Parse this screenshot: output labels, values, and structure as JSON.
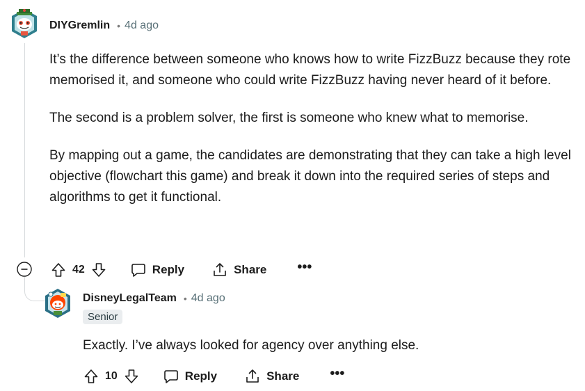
{
  "comment": {
    "author": "DIYGremlin",
    "separator": "•",
    "time": "4d ago",
    "paragraphs": [
      "It’s the difference between someone who knows how to write FizzBuzz because they rote memorised it, and someone who could write FizzBuzz having never heard of it before.",
      "The second is a problem solver, the first is someone who knew what to memorise.",
      "By mapping out a game, the candidates are demonstrating that they can take a high level objective (flowchart this game) and break it down into the required series of steps and algorithms to get it functional."
    ],
    "votes": "42",
    "reply_label": "Reply",
    "share_label": "Share",
    "more_label": "•••"
  },
  "reply": {
    "author": "DisneyLegalTeam",
    "separator": "•",
    "time": "4d ago",
    "flair": "Senior",
    "paragraphs": [
      "Exactly. I’ve always looked for agency over anything else."
    ],
    "votes": "10",
    "reply_label": "Reply",
    "share_label": "Share",
    "more_label": "•••"
  },
  "icons": {
    "collapse": "minus-circle-icon",
    "upvote": "arrow-up-icon",
    "downvote": "arrow-down-icon",
    "reply": "speech-bubble-icon",
    "share": "share-icon"
  },
  "colors": {
    "text": "#1c1c1c",
    "meta": "#576f76",
    "thread": "#d7dadc",
    "flair_bg": "#eaedef"
  }
}
